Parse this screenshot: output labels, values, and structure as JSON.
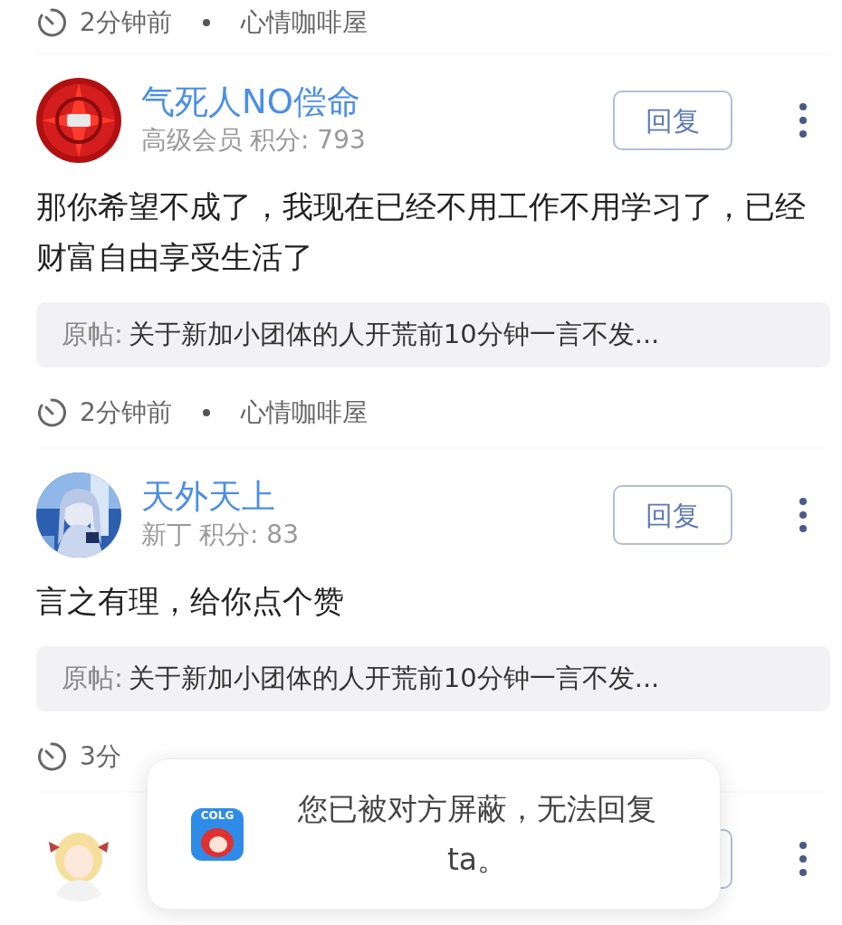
{
  "top_meta": {
    "time": "2分钟前",
    "forum": "心情咖啡屋"
  },
  "posts": [
    {
      "kind": "full",
      "name": "气死人NO偿命",
      "rank": "高级会员",
      "points": "积分: 793",
      "reply_button": "回复",
      "content": "那你希望不成了，我现在已经不用工作不用学习了，已经财富自由享受生活了",
      "quote_label": "原帖:",
      "quote_title": "关于新加小团体的人开荒前10分钟一言不发...",
      "time": "2分钟前",
      "forum": "心情咖啡屋"
    },
    {
      "kind": "full",
      "name": "天外天上",
      "rank": "新丁",
      "points": "积分: 83",
      "reply_button": "回复",
      "content": "言之有理，给你点个赞",
      "quote_label": "原帖:",
      "quote_title": "关于新加小团体的人开荒前10分钟一言不发...",
      "time": "3分"
    },
    {
      "kind": "covered"
    }
  ],
  "toast": {
    "icon_label": "COLG",
    "message": "您已被对方屏蔽，无法回复ta。"
  }
}
